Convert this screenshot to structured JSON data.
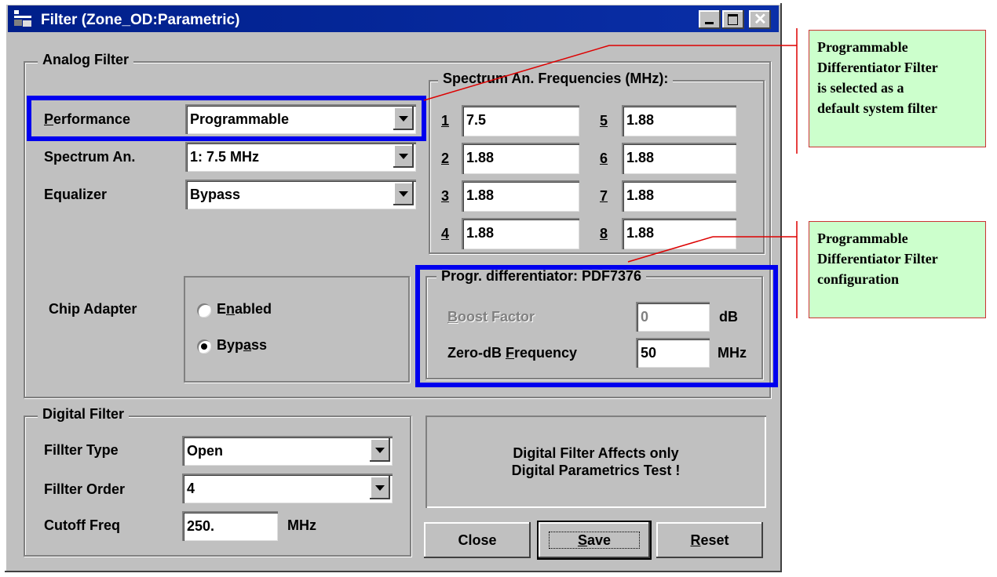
{
  "window": {
    "title": "Filter (Zone_OD:Parametric)"
  },
  "analog": {
    "group_title": "Analog  Filter",
    "performance": {
      "label": "Performance",
      "value": "Programmable"
    },
    "spectrum": {
      "label": "Spectrum An.",
      "value": "1: 7.5 MHz"
    },
    "equalizer": {
      "label": "Equalizer",
      "value": "Bypass"
    },
    "chip_adapter": {
      "label": "Chip Adapter",
      "enabled": "Enabled",
      "bypass": "Bypass"
    }
  },
  "spectrum_freqs": {
    "title": "Spectrum An. Frequencies (MHz):",
    "items": [
      {
        "n": "1",
        "v": "7.5"
      },
      {
        "n": "2",
        "v": "1.88"
      },
      {
        "n": "3",
        "v": "1.88"
      },
      {
        "n": "4",
        "v": "1.88"
      },
      {
        "n": "5",
        "v": "1.88"
      },
      {
        "n": "6",
        "v": "1.88"
      },
      {
        "n": "7",
        "v": "1.88"
      },
      {
        "n": "8",
        "v": "1.88"
      }
    ]
  },
  "pdf": {
    "title": "Progr. differentiator: PDF7376",
    "boost_label": "Boost Factor",
    "boost_value": "0",
    "boost_unit": "dB",
    "zero_label": "Zero-dB Frequency",
    "zero_value": "50",
    "zero_unit": "MHz"
  },
  "digital": {
    "group_title": "Digital Filter",
    "type": {
      "label": "Fillter Type",
      "value": "Open"
    },
    "order": {
      "label": "Fillter Order",
      "value": "4"
    },
    "cutoff": {
      "label": "Cutoff Freq",
      "value": "250.",
      "unit": "MHz"
    },
    "note_line1": "Digital Filter Affects only",
    "note_line2": "Digital Parametrics Test !"
  },
  "buttons": {
    "close": "Close",
    "save": "Save",
    "reset": "Reset"
  },
  "annotations": {
    "a1": [
      "Programmable",
      "Differentiator Filter",
      "is selected as a",
      "default system filter"
    ],
    "a2": [
      "Programmable",
      "Differentiator Filter",
      "configuration"
    ]
  },
  "colors": {
    "title_bar": "#0a2fa8",
    "highlight": "#0000ee",
    "note_bg": "#ccffcc",
    "note_border": "#cc3333"
  }
}
